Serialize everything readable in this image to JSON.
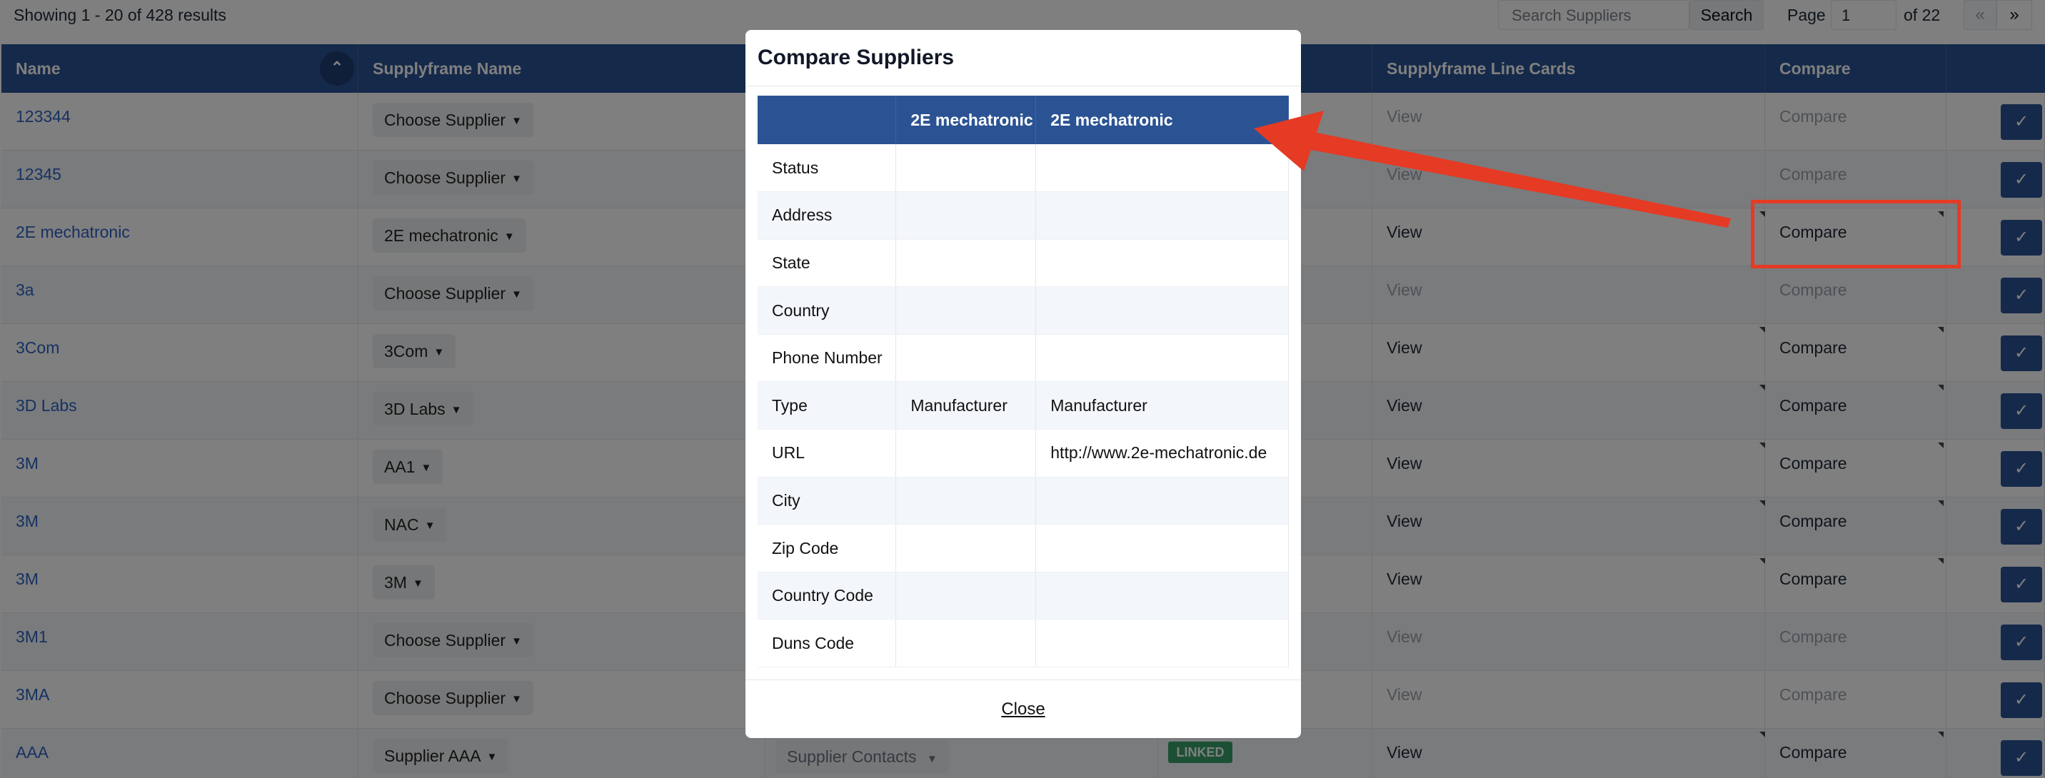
{
  "topbar": {
    "results_text": "Showing 1 - 20 of 428 results",
    "search_placeholder": "Search Suppliers",
    "search_button": "Search",
    "page_label": "Page",
    "page_value": "1",
    "page_of": "of 22",
    "prev_label": "«",
    "next_label": "»"
  },
  "table": {
    "headers": {
      "name": "Name",
      "supplyframe_name": "Supplyframe Name",
      "line_cards": "Supplyframe Line Cards",
      "compare": "Compare"
    },
    "sort_icon": "⌃",
    "rows": [
      {
        "name": "123344",
        "supplier": "Choose Supplier",
        "view": "View",
        "compare": "Compare"
      },
      {
        "name": "12345",
        "supplier": "Choose Supplier",
        "view": "View",
        "compare": "Compare"
      },
      {
        "name": "2E mechatronic",
        "supplier": "2E mechatronic",
        "view": "View",
        "compare": "Compare"
      },
      {
        "name": "3a",
        "supplier": "Choose Supplier",
        "view": "View",
        "compare": "Compare"
      },
      {
        "name": "3Com",
        "supplier": "3Com",
        "view": "View",
        "compare": "Compare"
      },
      {
        "name": "3D Labs",
        "supplier": "3D Labs",
        "view": "View",
        "compare": "Compare"
      },
      {
        "name": "3M",
        "supplier": "AA1",
        "view": "View",
        "compare": "Compare"
      },
      {
        "name": "3M",
        "supplier": "NAC",
        "view": "View",
        "compare": "Compare"
      },
      {
        "name": "3M",
        "supplier": "3M",
        "view": "View",
        "compare": "Compare"
      },
      {
        "name": "3M1",
        "supplier": "Choose Supplier",
        "view": "View",
        "compare": "Compare"
      },
      {
        "name": "3MA",
        "supplier": "Choose Supplier",
        "view": "View",
        "compare": "Compare"
      },
      {
        "name": "AAA",
        "supplier": "Supplier AAA",
        "view": "View",
        "compare": "Compare"
      }
    ],
    "supplier_contacts": "Supplier Contacts",
    "linked_badge": "LINKED",
    "check_icon": "✓"
  },
  "modal": {
    "title": "Compare Suppliers",
    "columns": [
      "",
      "2E mechatronic",
      "2E mechatronic"
    ],
    "rows": [
      {
        "label": "Status",
        "a": "",
        "b": ""
      },
      {
        "label": "Address",
        "a": "",
        "b": ""
      },
      {
        "label": "State",
        "a": "",
        "b": ""
      },
      {
        "label": "Country",
        "a": "",
        "b": ""
      },
      {
        "label": "Phone Number",
        "a": "",
        "b": ""
      },
      {
        "label": "Type",
        "a": "Manufacturer",
        "b": "Manufacturer"
      },
      {
        "label": "URL",
        "a": "",
        "b": "http://www.2e-mechatronic.de"
      },
      {
        "label": "City",
        "a": "",
        "b": ""
      },
      {
        "label": "Zip Code",
        "a": "",
        "b": ""
      },
      {
        "label": "Country Code",
        "a": "",
        "b": ""
      },
      {
        "label": "Duns Code",
        "a": "",
        "b": ""
      }
    ],
    "close_label": "Close"
  },
  "colors": {
    "header_blue": "#2b5394",
    "link_blue": "#2c63c4",
    "annotation_red": "#e53a24",
    "linked_green": "#38a169"
  }
}
